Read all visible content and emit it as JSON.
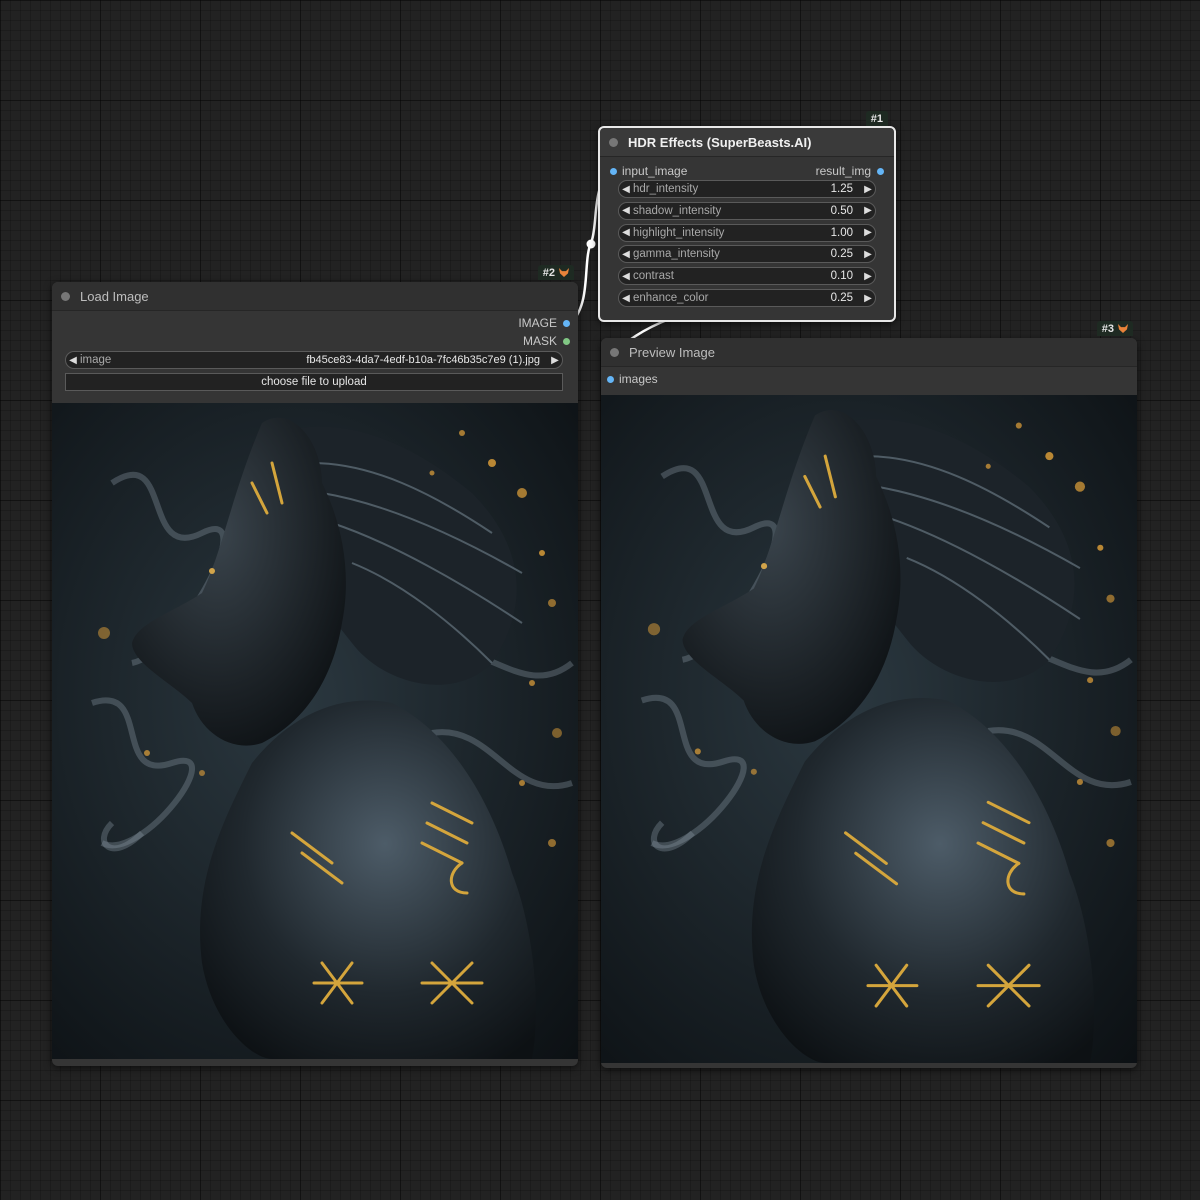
{
  "hdr_node": {
    "id": "#1",
    "title": "HDR Effects (SuperBeasts.AI)",
    "input_label": "input_image",
    "output_label": "result_img",
    "widgets": [
      {
        "label": "hdr_intensity",
        "value": "1.25"
      },
      {
        "label": "shadow_intensity",
        "value": "0.50"
      },
      {
        "label": "highlight_intensity",
        "value": "1.00"
      },
      {
        "label": "gamma_intensity",
        "value": "0.25"
      },
      {
        "label": "contrast",
        "value": "0.10"
      },
      {
        "label": "enhance_color",
        "value": "0.25"
      }
    ]
  },
  "load_node": {
    "id": "#2",
    "title": "Load Image",
    "outputs": [
      "IMAGE",
      "MASK"
    ],
    "image_widget": {
      "label": "image",
      "value": "fb45ce83-4da7-4edf-b10a-7fc46b35c7e9 (1).jpg"
    },
    "upload_label": "choose file to upload"
  },
  "preview_node": {
    "id": "#3",
    "title": "Preview Image",
    "input_label": "images"
  },
  "colors": {
    "canvas": "#222222",
    "node_body": "#353535",
    "image_slot": "#64b5f6",
    "mask_slot": "#81c784",
    "link": "#ffffff",
    "gold": "#d4a53c"
  },
  "icons": {
    "arrow_left": "triangle-left-icon",
    "arrow_right": "triangle-right-icon",
    "badge": "fox-icon"
  }
}
